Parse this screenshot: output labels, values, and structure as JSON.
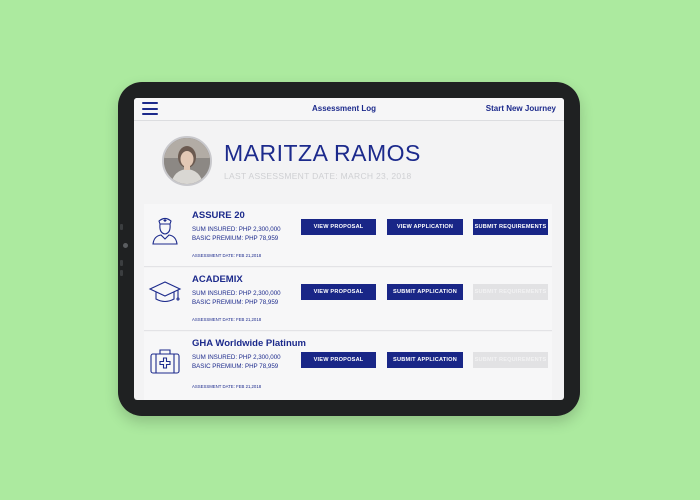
{
  "header": {
    "nav_center": "Assessment Log",
    "nav_right": "Start New Journey"
  },
  "profile": {
    "name": "MARITZA RAMOS",
    "last_assessment": "LAST ASSESSMENT DATE: MARCH 23, 2018"
  },
  "products": [
    {
      "title": "ASSURE 20",
      "sum_insured": "SUM INSURED: PHP 2,300,000",
      "basic_premium": "BASIC PREMIUM: PHP 78,959",
      "assessment_date": "ASSESSMENT DATE: FEB 21,2018",
      "icon": "nurse-icon",
      "buttons": [
        {
          "label": "VIEW PROPOSAL",
          "enabled": true
        },
        {
          "label": "VIEW APPLICATION",
          "enabled": true
        },
        {
          "label": "SUBMIT REQUIREMENTS",
          "enabled": true
        }
      ]
    },
    {
      "title": "ACADEMIX",
      "sum_insured": "SUM INSURED: PHP 2,300,000",
      "basic_premium": "BASIC PREMIUM: PHP 78,959",
      "assessment_date": "ASSESSMENT DATE: FEB 21,2018",
      "icon": "graduation-cap-icon",
      "buttons": [
        {
          "label": "VIEW PROPOSAL",
          "enabled": true
        },
        {
          "label": "SUBMIT APPLICATION",
          "enabled": true
        },
        {
          "label": "SUBMIT REQUIREMENTS",
          "enabled": false
        }
      ]
    },
    {
      "title": "GHA Worldwide Platinum",
      "sum_insured": "SUM INSURED: PHP 2,300,000",
      "basic_premium": "BASIC PREMIUM: PHP 78,959",
      "assessment_date": "ASSESSMENT DATE: FEB 21,2018",
      "icon": "medical-kit-icon",
      "buttons": [
        {
          "label": "VIEW PROPOSAL",
          "enabled": true
        },
        {
          "label": "SUBMIT APPLICATION",
          "enabled": true
        },
        {
          "label": "SUBMIT REQUIREMENTS",
          "enabled": false
        }
      ]
    }
  ],
  "colors": {
    "background": "#acea9f",
    "bezel": "#1f2122",
    "accent": "#1c2a8c",
    "button": "#192687",
    "disabled": "#e2e2e4"
  }
}
